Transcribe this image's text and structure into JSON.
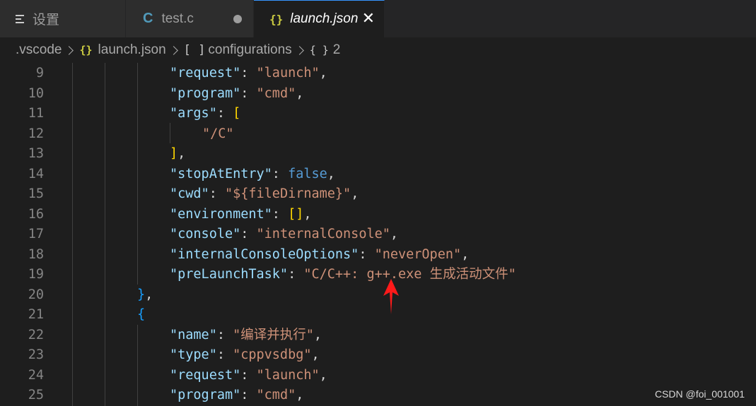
{
  "tabs": [
    {
      "label": "设置",
      "icon": "settings-lines-icon"
    },
    {
      "label": "test.c",
      "icon": "c-file-icon",
      "prefix": "C"
    },
    {
      "label": "launch.json",
      "icon": "json-braces-icon",
      "prefix": "{}",
      "close": "✕"
    }
  ],
  "breadcrumb": {
    "folder": ".vscode",
    "file": "launch.json",
    "array_icon": "[ ]",
    "array": "configurations",
    "object_icon": "{ }",
    "object": "2"
  },
  "lines": [
    {
      "n": "9",
      "t": [
        [
          "k",
          "\"request\""
        ],
        [
          "p",
          ": "
        ],
        [
          "s",
          "\"launch\""
        ],
        [
          "p",
          ","
        ]
      ]
    },
    {
      "n": "10",
      "t": [
        [
          "k",
          "\"program\""
        ],
        [
          "p",
          ": "
        ],
        [
          "s",
          "\"cmd\""
        ],
        [
          "p",
          ","
        ]
      ]
    },
    {
      "n": "11",
      "t": [
        [
          "k",
          "\"args\""
        ],
        [
          "p",
          ": "
        ],
        [
          "b1",
          "["
        ]
      ]
    },
    {
      "n": "12",
      "t": [
        [
          "s",
          "\"/C\""
        ]
      ]
    },
    {
      "n": "13",
      "t": [
        [
          "b1",
          "]"
        ],
        [
          "p",
          ","
        ]
      ]
    },
    {
      "n": "14",
      "t": [
        [
          "k",
          "\"stopAtEntry\""
        ],
        [
          "p",
          ": "
        ],
        [
          "kw",
          "false"
        ],
        [
          "p",
          ","
        ]
      ]
    },
    {
      "n": "15",
      "t": [
        [
          "k",
          "\"cwd\""
        ],
        [
          "p",
          ": "
        ],
        [
          "s",
          "\"${fileDirname}\""
        ],
        [
          "p",
          ","
        ]
      ]
    },
    {
      "n": "16",
      "t": [
        [
          "k",
          "\"environment\""
        ],
        [
          "p",
          ": "
        ],
        [
          "b1",
          "[]"
        ],
        [
          "p",
          ","
        ]
      ]
    },
    {
      "n": "17",
      "t": [
        [
          "k",
          "\"console\""
        ],
        [
          "p",
          ": "
        ],
        [
          "s",
          "\"internalConsole\""
        ],
        [
          "p",
          ","
        ]
      ]
    },
    {
      "n": "18",
      "t": [
        [
          "k",
          "\"internalConsoleOptions\""
        ],
        [
          "p",
          ": "
        ],
        [
          "s",
          "\"neverOpen\""
        ],
        [
          "p",
          ","
        ]
      ]
    },
    {
      "n": "19",
      "t": [
        [
          "k",
          "\"preLaunchTask\""
        ],
        [
          "p",
          ": "
        ],
        [
          "s",
          "\"C/C++: g++.exe 生成活动文件\""
        ]
      ]
    },
    {
      "n": "20",
      "t": [
        [
          "b2",
          "}"
        ],
        [
          "p",
          ","
        ]
      ]
    },
    {
      "n": "21",
      "t": [
        [
          "b2",
          "{"
        ]
      ]
    },
    {
      "n": "22",
      "t": [
        [
          "k",
          "\"name\""
        ],
        [
          "p",
          ": "
        ],
        [
          "s",
          "\"编译并执行\""
        ],
        [
          "p",
          ","
        ]
      ]
    },
    {
      "n": "23",
      "t": [
        [
          "k",
          "\"type\""
        ],
        [
          "p",
          ": "
        ],
        [
          "s",
          "\"cppvsdbg\""
        ],
        [
          "p",
          ","
        ]
      ]
    },
    {
      "n": "24",
      "t": [
        [
          "k",
          "\"request\""
        ],
        [
          "p",
          ": "
        ],
        [
          "s",
          "\"launch\""
        ],
        [
          "p",
          ","
        ]
      ]
    },
    {
      "n": "25",
      "t": [
        [
          "k",
          "\"program\""
        ],
        [
          "p",
          ": "
        ],
        [
          "s",
          "\"cmd\""
        ],
        [
          "p",
          ","
        ]
      ]
    }
  ],
  "watermark": "CSDN @foi_001001",
  "colors": {
    "key": "#9cdcfe",
    "string": "#ce9178",
    "keyword": "#569cd6",
    "bracket_gold": "#ffd700",
    "bracket_blue": "#179fff",
    "arrow": "#ff1a1a",
    "accent": "#3794ff"
  }
}
